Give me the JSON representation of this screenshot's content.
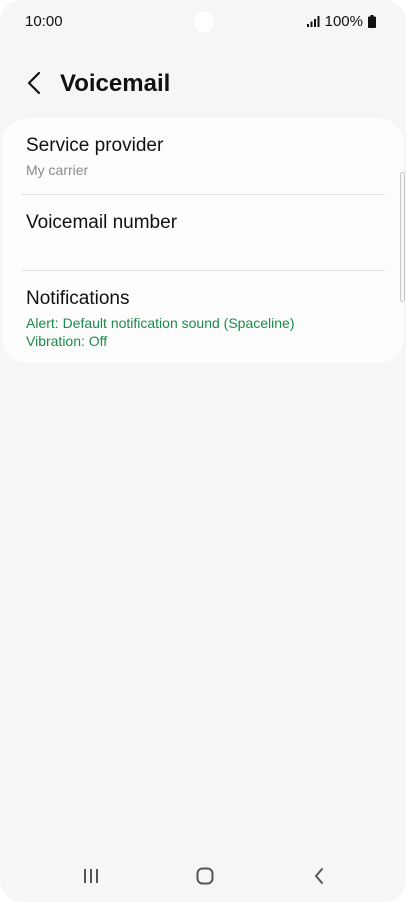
{
  "status_bar": {
    "time": "10:00",
    "battery": "100%",
    "signal_icon": "signal-icon",
    "battery_icon": "battery-icon"
  },
  "header": {
    "title": "Voicemail",
    "back_icon": "back-arrow-icon"
  },
  "settings": {
    "items": [
      {
        "title": "Service provider",
        "subtitle": "My carrier"
      },
      {
        "title": "Voicemail number"
      },
      {
        "title": "Notifications",
        "line1": "Alert: Default notification sound (Spaceline)",
        "line2": "Vibration: Off"
      }
    ]
  },
  "colors": {
    "background": "#f6f6f6",
    "card": "#fdfdfd",
    "accent_green": "#1c8a4a",
    "secondary_text": "#8a8a8a"
  },
  "nav_bar": {
    "recents_icon": "recents-icon",
    "home_icon": "home-icon",
    "back_icon": "back-icon"
  }
}
